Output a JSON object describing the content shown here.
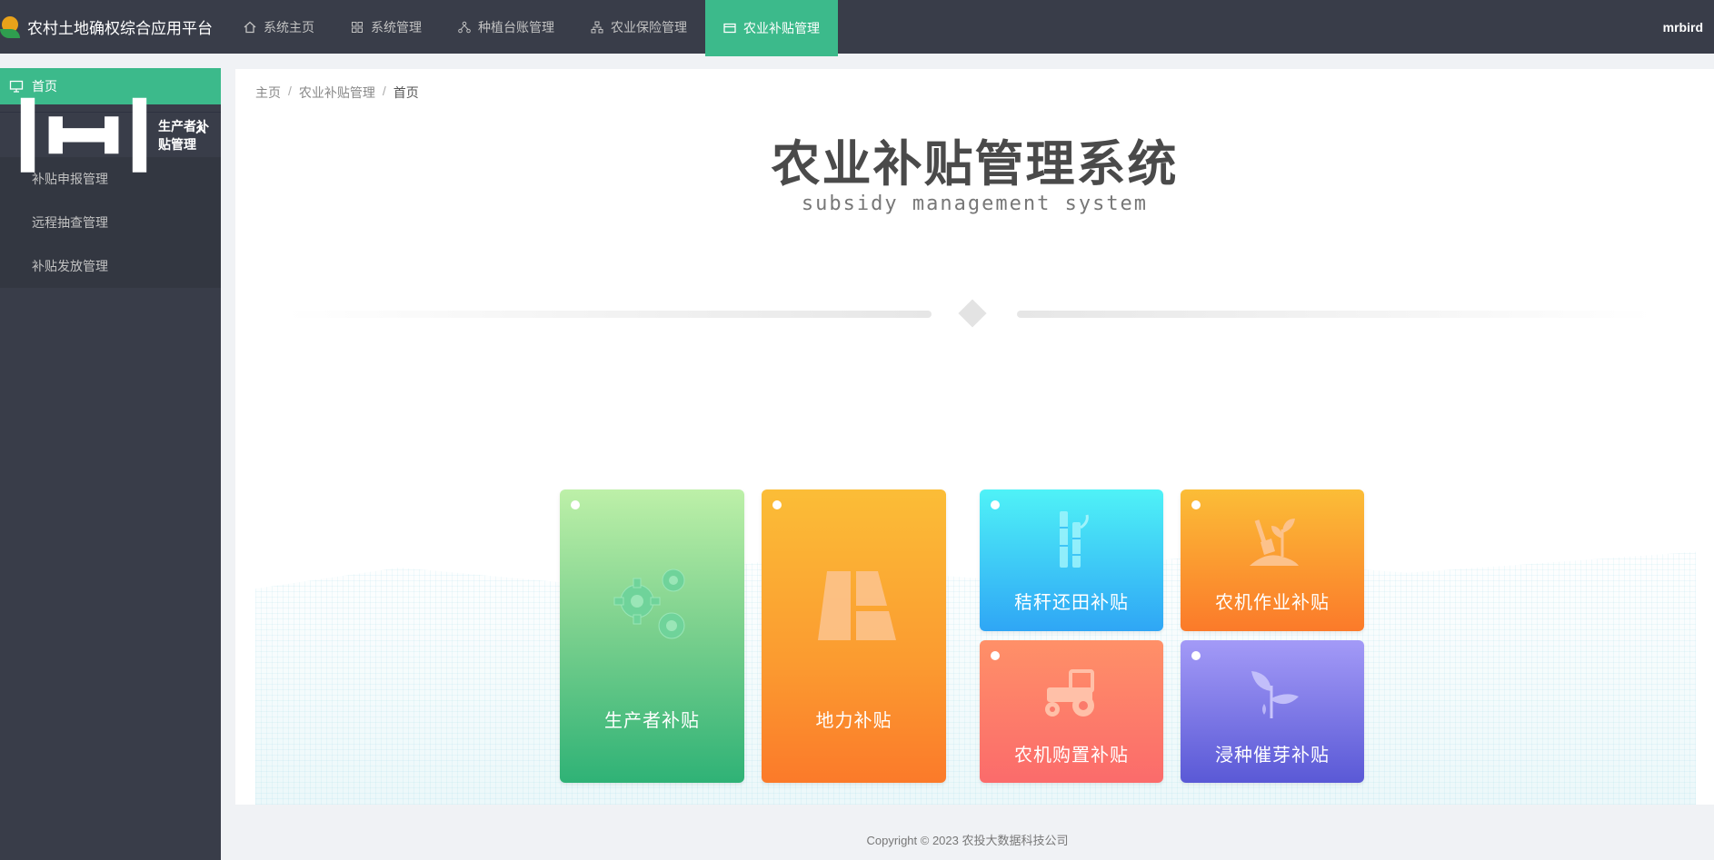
{
  "header": {
    "app_title": "农村土地确权综合应用平台",
    "user": "mrbird",
    "nav": [
      {
        "label": "系统主页",
        "icon": "home-icon"
      },
      {
        "label": "系统管理",
        "icon": "grid-icon"
      },
      {
        "label": "种植台账管理",
        "icon": "tree-icon"
      },
      {
        "label": "农业保险管理",
        "icon": "org-icon"
      },
      {
        "label": "农业补贴管理",
        "icon": "card-icon",
        "active": true
      }
    ]
  },
  "sidebar": {
    "home": {
      "label": "首页",
      "icon": "monitor-icon"
    },
    "group": {
      "label": "生产者补贴管理",
      "icon": "gauge-icon"
    },
    "sub_items": [
      {
        "label": "补贴申报管理"
      },
      {
        "label": "远程抽查管理"
      },
      {
        "label": "补贴发放管理"
      }
    ]
  },
  "breadcrumb": [
    "主页",
    "农业补贴管理",
    "首页"
  ],
  "breadcrumb_sep": "/",
  "hero": {
    "title": "农业补贴管理系统",
    "subtitle": "subsidy management system"
  },
  "cards": [
    {
      "label": "生产者补贴",
      "icon": "gears-icon"
    },
    {
      "label": "地力补贴",
      "icon": "field-icon"
    },
    {
      "label": "秸秆还田补贴",
      "icon": "bamboo-icon"
    },
    {
      "label": "农机作业补贴",
      "icon": "shovel-plant-icon"
    },
    {
      "label": "农机购置补贴",
      "icon": "tractor-icon"
    },
    {
      "label": "浸种催芽补贴",
      "icon": "sprout-icon"
    }
  ],
  "footer": {
    "copyright": "Copyright © 2023 农投大数据科技公司"
  },
  "colors": {
    "header_bg": "#393d49",
    "accent": "#3cba8b"
  }
}
